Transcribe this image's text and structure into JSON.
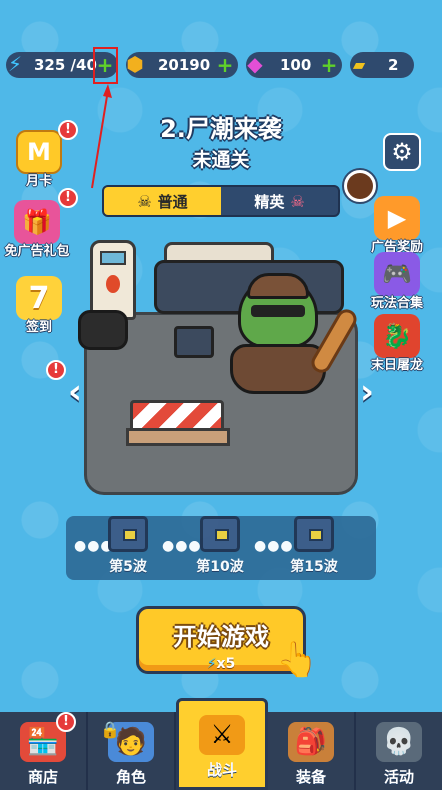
{
  "resources": {
    "energy": {
      "value": "325 /40",
      "icon": "lightning-icon"
    },
    "gold": {
      "value": "20190",
      "icon": "coin-icon"
    },
    "gems": {
      "value": "100",
      "icon": "diamond-icon"
    },
    "tickets": {
      "value": "2",
      "icon": "ads-ticket-icon"
    },
    "plus": "+"
  },
  "stage": {
    "title": "2.尸潮来袭",
    "status": "未通关"
  },
  "mode_tabs": [
    {
      "label": "普通"
    },
    {
      "label": "精英"
    }
  ],
  "left_icons": [
    {
      "label": "月卡",
      "glyph": "M",
      "badge": "!"
    },
    {
      "label": "免广告礼包",
      "glyph": "🎁",
      "badge": "!"
    },
    {
      "label": "签到",
      "glyph": "7",
      "badge": ""
    }
  ],
  "right_icons": [
    {
      "label": "广告奖励",
      "glyph": "▶"
    },
    {
      "label": "玩法合集",
      "glyph": "🎮"
    },
    {
      "label": "末日屠龙",
      "glyph": "🐉"
    }
  ],
  "scene_badge": "!",
  "arrows": {
    "left": "‹",
    "right": "›"
  },
  "waves": [
    {
      "label": "第5波"
    },
    {
      "label": "第10波"
    },
    {
      "label": "第15波"
    }
  ],
  "start_button": {
    "label": "开始游戏",
    "cost": "x5"
  },
  "bottom_nav": [
    {
      "label": "商店",
      "glyph": "🏪",
      "badge": "!"
    },
    {
      "label": "角色",
      "glyph": "🧑",
      "badge": ""
    },
    {
      "label": "战斗",
      "glyph": "⚔",
      "badge": ""
    },
    {
      "label": "装备",
      "glyph": "🎒",
      "badge": ""
    },
    {
      "label": "活动",
      "glyph": "💀",
      "badge": ""
    }
  ],
  "colors": {
    "background": "#4fb8e8",
    "panel": "#2f4a6e",
    "accent_yellow": "#ffcf2e",
    "plus_green": "#5fd12a",
    "badge_red": "#e63a3a"
  }
}
